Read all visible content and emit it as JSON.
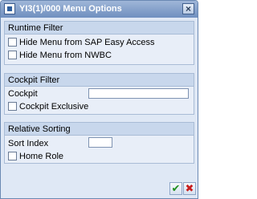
{
  "window": {
    "title": "YI3(1)/000 Menu Options",
    "icons": {
      "title": "sap-window-icon",
      "close": "close-icon",
      "ok": "checkmark-icon",
      "cancel": "cancel-icon"
    },
    "colors": {
      "titlebar": "#7f9cc8",
      "group_header": "#c8d7ec",
      "background": "#dfe8f5"
    }
  },
  "runtime_filter": {
    "title": "Runtime Filter",
    "hide_sap_easy_access": {
      "label": "Hide Menu from SAP Easy Access",
      "checked": false
    },
    "hide_nwbc": {
      "label": "Hide Menu from NWBC",
      "checked": false
    }
  },
  "cockpit_filter": {
    "title": "Cockpit Filter",
    "cockpit_label": "Cockpit",
    "cockpit_value": "",
    "cockpit_exclusive": {
      "label": "Cockpit Exclusive",
      "checked": false
    }
  },
  "relative_sorting": {
    "title": "Relative Sorting",
    "sort_index_label": "Sort Index",
    "sort_index_value": "",
    "home_role": {
      "label": "Home Role",
      "checked": false
    }
  },
  "buttons": {
    "ok_symbol": "✔",
    "cancel_symbol": "✖",
    "close_symbol": "×"
  }
}
